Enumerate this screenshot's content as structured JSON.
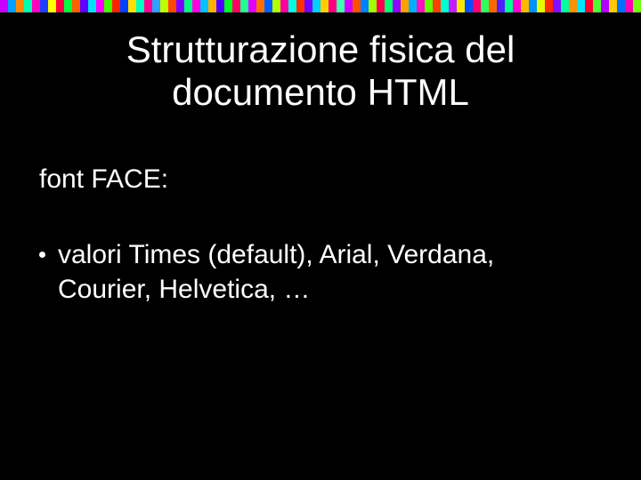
{
  "band_colors": [
    "#c800ff",
    "#00a0ff",
    "#ff8800",
    "#00ffb0",
    "#ff00c0",
    "#2040ff",
    "#ffff00",
    "#ff0040",
    "#00ff40",
    "#ff6000",
    "#6000ff",
    "#00e0ff",
    "#ff00ff",
    "#40ff00",
    "#ff2000",
    "#0040ff",
    "#ffe000",
    "#00ffc0",
    "#ff0090",
    "#30a0ff",
    "#c0ff00",
    "#ff4800",
    "#8000ff",
    "#00ff80",
    "#ff00e0",
    "#00c0ff",
    "#ffb000",
    "#5000ff",
    "#00ff20",
    "#ff0060",
    "#20ff90",
    "#e000ff",
    "#ff7000",
    "#0060ff",
    "#b0ff00",
    "#ff00a0",
    "#00ffe0",
    "#ff3000",
    "#7000ff",
    "#00d0ff",
    "#ffd000",
    "#ff0080",
    "#40ffb0",
    "#d000ff",
    "#ff5000",
    "#0080ff",
    "#a0ff00",
    "#ff0050",
    "#00ff70",
    "#9000ff",
    "#ffa000",
    "#00b0ff",
    "#ff10c0",
    "#60ff00",
    "#ff4000",
    "#00ffd0",
    "#c020ff",
    "#ffe800",
    "#0050ff",
    "#ff0070",
    "#30ff60",
    "#ff6800",
    "#5020ff",
    "#00ff90",
    "#ff00d0",
    "#ffb800",
    "#0090ff",
    "#e0ff00",
    "#ff2800",
    "#8010ff",
    "#00ffa0",
    "#ff9000",
    "#00e8ff",
    "#ff0030",
    "#50ff30",
    "#b000ff",
    "#ffc800",
    "#0070ff",
    "#ff00b0",
    "#70ff10"
  ],
  "title": "Strutturazione fisica del documento HTML",
  "subhead": "font FACE:",
  "bullets": [
    "valori Times (default), Arial, Verdana, Courier, Helvetica, …"
  ]
}
